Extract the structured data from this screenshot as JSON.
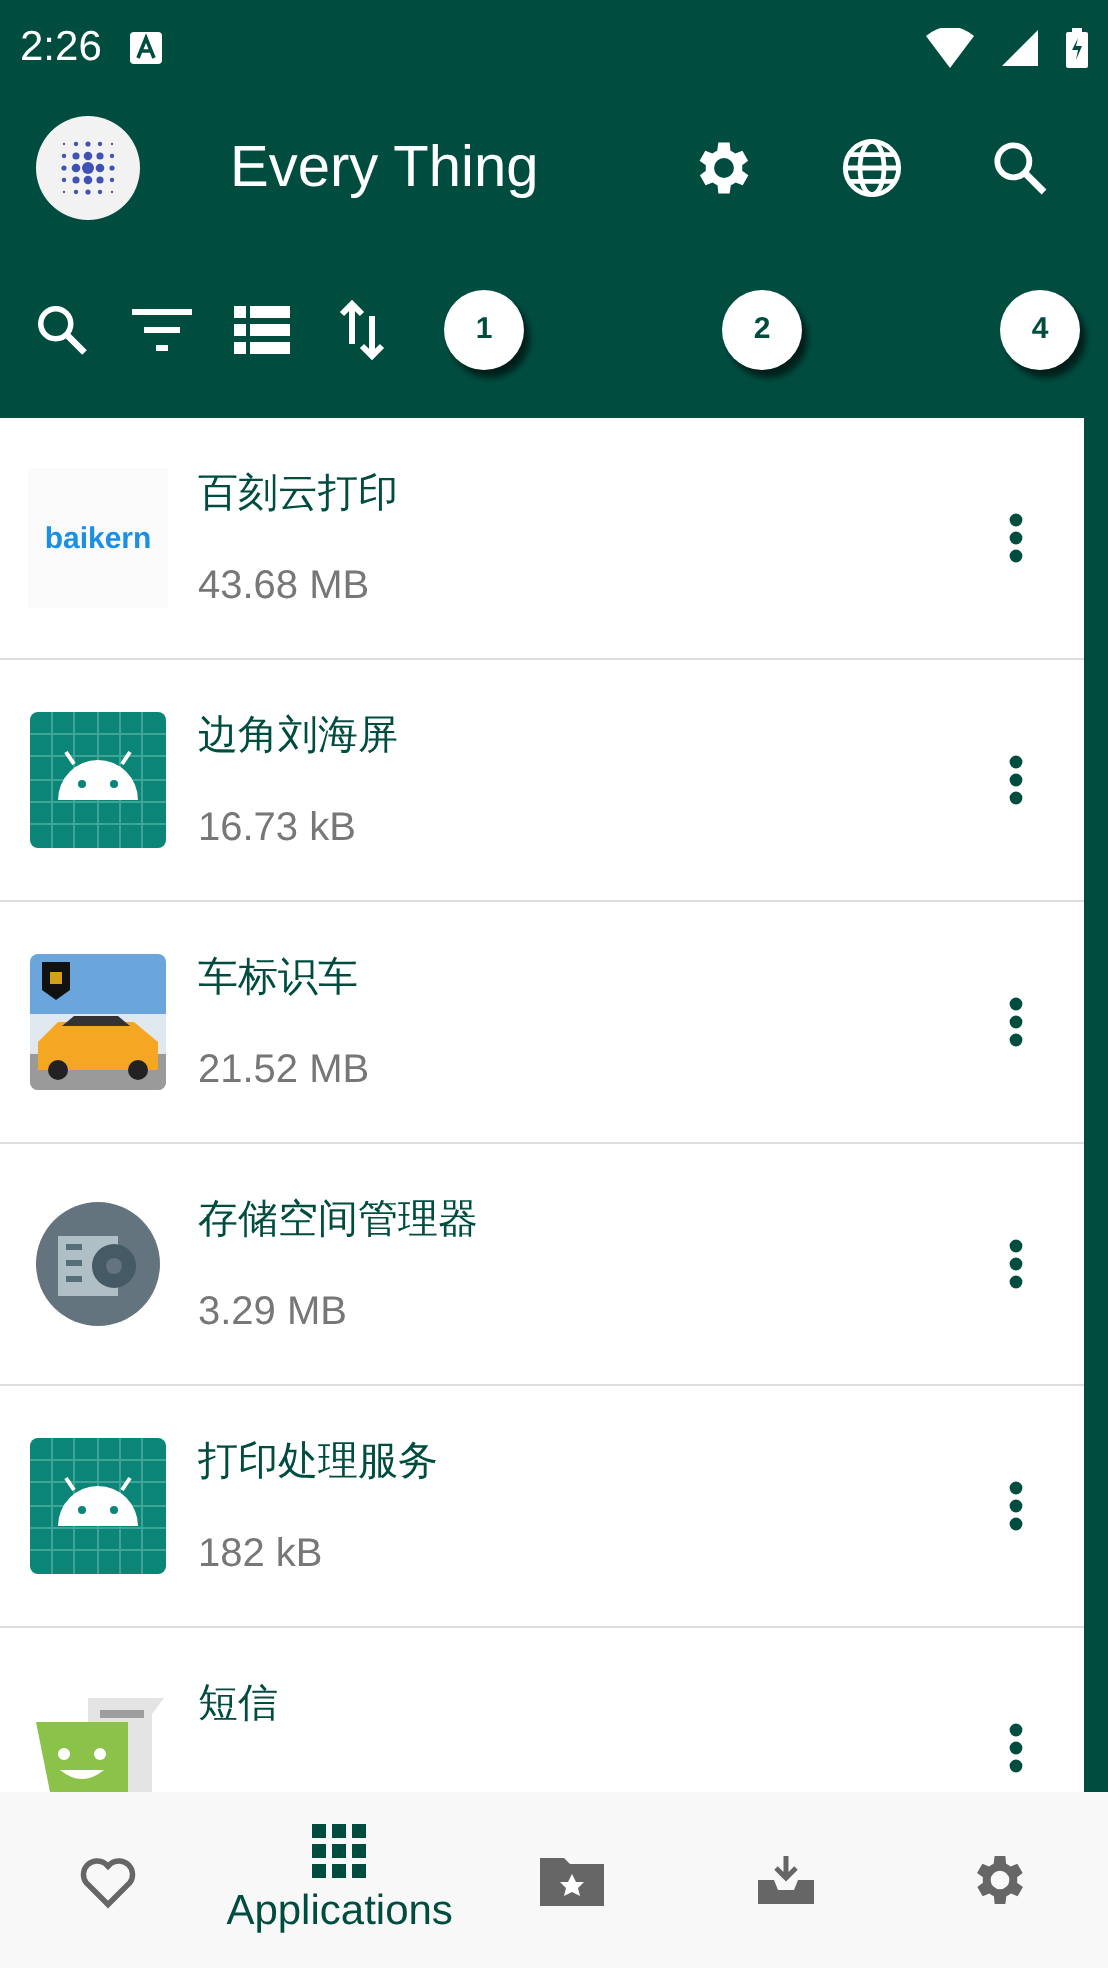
{
  "status_bar": {
    "time": "2:26"
  },
  "app_bar": {
    "title": "Every Thing"
  },
  "toolbar": {
    "badges": [
      "1",
      "2",
      "4"
    ]
  },
  "apps": [
    {
      "name": "百刻云打印",
      "size": "43.68 MB",
      "icon": {
        "kind": "logo",
        "text": "baikern"
      }
    },
    {
      "name": "边角刘海屏",
      "size": "16.73 kB",
      "icon": {
        "kind": "android"
      }
    },
    {
      "name": "车标识车",
      "size": "21.52 MB"
    },
    {
      "name": "存储空间管理器",
      "size": "3.29 MB",
      "icon": {
        "kind": "storage"
      }
    },
    {
      "name": "打印处理服务",
      "size": "182 kB",
      "icon": {
        "kind": "android"
      }
    },
    {
      "name": "短信",
      "icon": {
        "kind": "sms"
      }
    }
  ],
  "bottom_nav": [
    {
      "kind": "favorites",
      "selected": false
    },
    {
      "kind": "apps",
      "label": "Applications",
      "selected": true
    },
    {
      "kind": "folder",
      "selected": false
    },
    {
      "kind": "tray",
      "selected": false
    },
    {
      "kind": "settings",
      "selected": false
    }
  ]
}
